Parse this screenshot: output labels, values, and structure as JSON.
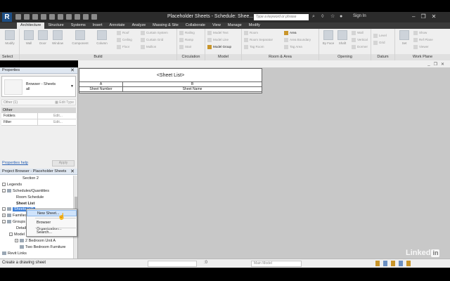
{
  "window": {
    "title": "Placeholder Sheets - Schedule: Shee...",
    "search_placeholder": "Type a keyword or phrase",
    "sign_in": "Sign In",
    "app_logo": "R"
  },
  "ribbon_tabs": [
    "Architecture",
    "Structure",
    "Systems",
    "Insert",
    "Annotate",
    "Analyze",
    "Massing & Site",
    "Collaborate",
    "View",
    "Manage",
    "Modify"
  ],
  "ribbon": {
    "select_label": "Select",
    "modify": "Modify",
    "build": {
      "label": "Build",
      "big": [
        "Wall",
        "Door",
        "Window",
        "Component",
        "Column"
      ],
      "small": [
        "Roof",
        "Ceiling",
        "Floor",
        "Curtain System",
        "Curtain Grid",
        "Mullion"
      ]
    },
    "circulation": {
      "label": "Circulation",
      "items": [
        "Railing",
        "Ramp",
        "Stair"
      ]
    },
    "model": {
      "label": "Model",
      "items": [
        "Model Text",
        "Model Line",
        "Model Group"
      ]
    },
    "room_area": {
      "label": "Room & Area",
      "items": [
        "Room",
        "Room Separator",
        "Tag Room",
        "Area",
        "Area Boundary",
        "Tag Area"
      ]
    },
    "opening": {
      "label": "Opening",
      "items": [
        "By Face",
        "Shaft",
        "Wall",
        "Vertical",
        "Dormer"
      ]
    },
    "datum": {
      "label": "Datum",
      "items": [
        "Level",
        "Grid"
      ]
    },
    "work_plane": {
      "label": "Work Plane",
      "items": [
        "Set",
        "Show",
        "Ref Plane",
        "Viewer"
      ]
    }
  },
  "schedule": {
    "title": "<Sheet List>",
    "col_a_letter": "A",
    "col_b_letter": "B",
    "col_a_header": "Sheet Number",
    "col_b_header": "Sheet Name"
  },
  "properties": {
    "title": "Properties",
    "type_line1": "Browser - Sheets",
    "type_line2": "all",
    "instance": "Other (1)",
    "edit_type": "Edit Type",
    "group": "Other",
    "rows": [
      {
        "key": "Folders",
        "value": "Edit..."
      },
      {
        "key": "Filter",
        "value": "Edit..."
      }
    ],
    "help_link": "Properties help",
    "apply": "Apply"
  },
  "browser": {
    "title": "Project Browser - Placeholder Sheets",
    "items": {
      "section2": "Section 2",
      "legends": "Legends",
      "schedules": "Schedules/Quantities",
      "room_schedule": "Room Schedule",
      "sheet_list": "Sheet List",
      "sheets": "Sheets (all)",
      "families": "Families",
      "groups": "Groups",
      "detail": "Detail",
      "model": "Model",
      "unit_a": "2 Bedroom Unit A",
      "furniture": "Two Bedroom Furniture",
      "revit_links": "Revit Links"
    }
  },
  "context_menu": {
    "new_sheet": "New Sheet...",
    "browser_org": "Browser Organization...",
    "search": "Search..."
  },
  "status": {
    "text": "Create a drawing sheet",
    "model": "Main Model",
    "count": ":0"
  },
  "watermark": {
    "text": "Linked",
    "badge": "in"
  },
  "colors": {
    "accent": "#3d7fd8",
    "titlebar": "#2b2b2b",
    "canvas": "#c8c8c8"
  }
}
